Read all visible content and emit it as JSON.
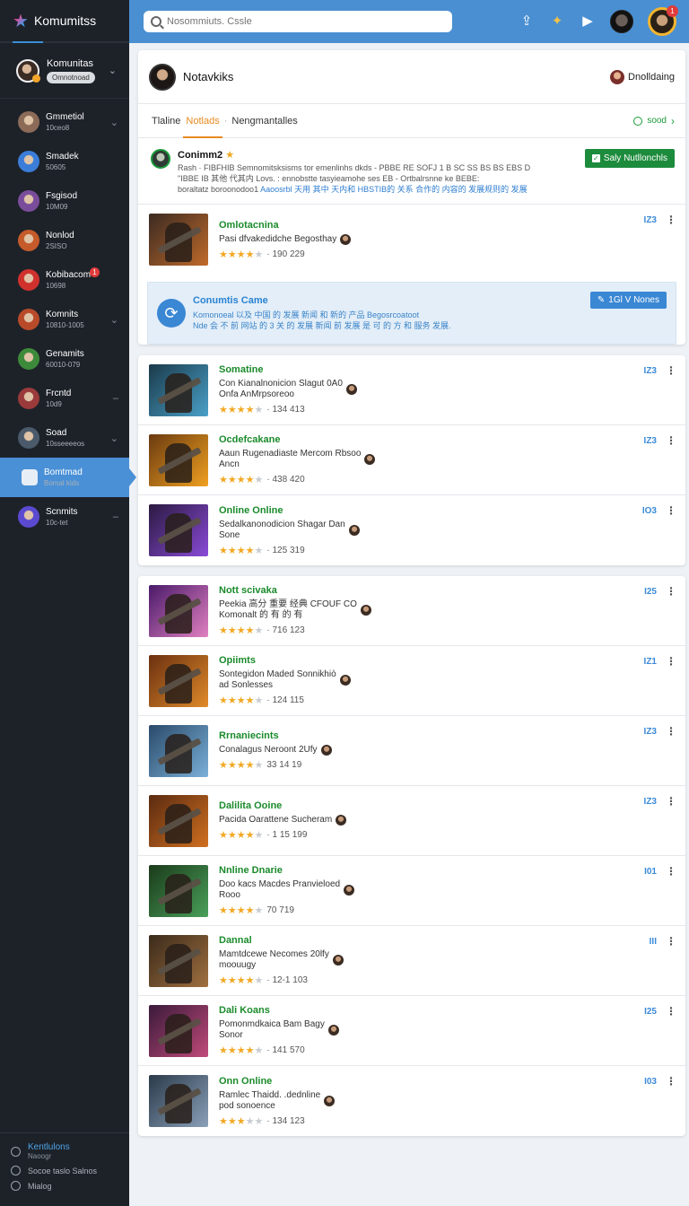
{
  "sidebar": {
    "brand": "Komumitss",
    "profile": {
      "name": "Komunitas",
      "pill": "Omnotnoad"
    },
    "items": [
      {
        "t1": "Gmmetiol",
        "t2": "10ceo8",
        "color": "#8b6b58",
        "chev": "⌄"
      },
      {
        "t1": "Smadek",
        "t2": "50605",
        "color": "#3b7dd8",
        "chev": ""
      },
      {
        "t1": "Fsgisod",
        "t2": "10M09",
        "color": "#7a4d9b",
        "chev": ""
      },
      {
        "t1": "Nonlod",
        "t2": "2SISO",
        "color": "#c55a2a",
        "chev": ""
      },
      {
        "t1": "Kobibacom",
        "t2": "10698",
        "color": "#d0312d",
        "chev": "",
        "badge": "1"
      },
      {
        "t1": "Komnits",
        "t2": "10810-1005",
        "color": "#b84a2a",
        "chev": "⌄"
      },
      {
        "t1": "Genamits",
        "t2": "60010-079",
        "color": "#3c8a3a",
        "chev": ""
      },
      {
        "t1": "Frcntd",
        "t2": "10d9",
        "color": "#9a3a3a",
        "chev": "–"
      },
      {
        "t1": "Soad",
        "t2": "10sseeeeos",
        "color": "#4a5a6a",
        "chev": "⌄"
      },
      {
        "t1": "Bomtmad",
        "t2": "Bomal kids",
        "color": "#2d6cb0",
        "chev": "",
        "active": true
      },
      {
        "t1": "Scnmits",
        "t2": "10c-tet",
        "color": "#5b4ad0",
        "chev": "–"
      }
    ],
    "footer": {
      "line1": "Kentlulons",
      "line1b": "Naoogr",
      "line2": "Socoe taslo Salnos",
      "line3": "Mialog"
    }
  },
  "topbar": {
    "search_placeholder": "Nosommiuts. Cssle"
  },
  "header": {
    "title": "Notavkiks",
    "right_label": "Dnolldaing"
  },
  "tabs": {
    "items": [
      "Tlaline",
      "Notlads",
      "Nengmantalles"
    ],
    "active": 1,
    "right_label": "sood"
  },
  "notice": {
    "title": "Conimm2",
    "text1": "Rash · FIBFHIB Semnomitsksisms tor emenlinhs dkds - PBBE RE SOFJ 1 B SC SS BS BS EBS D",
    "text2": "\"IBBE IB 其他 代其内 Lovs. : ennobstte tasyieamohe ses EB - Ortbalrsnne ke BEBE:",
    "text3": "boraltatz boroonodoo1",
    "text3hl": "Aaoosrbl 天用 其中 天内和 HBSTIB的 关系 合作的 内容的 发展规则的 发展",
    "button": "Saly Nutllonchls"
  },
  "rows_a": [
    {
      "title": "Omlotacnina",
      "desc": "Pasi dfvakedidche Begosthay",
      "desc2": "",
      "rating": 4,
      "meta": "· 190 229",
      "tag": "IZ3",
      "thumb": [
        "#3a2a22",
        "#c06a2a"
      ]
    }
  ],
  "promo": {
    "title": "Conumtis Came",
    "text1": "Komonoeal 以及 中国 的 发展 新闻 和 新的 产品 Begosrcoatoot",
    "text2": "Nde 会 不 前 网站 的 3 关 的 发展 新闻 前 发展 是 可 的 方 和 服务 发展.",
    "button": "1Gl V Nones"
  },
  "rows_b": [
    {
      "title": "Somatine",
      "desc": "Con Kianalnonicion Slagut 0A0",
      "desc2": "Onfa AnMrpsoreoo",
      "rating": 4,
      "meta": "· 134 413",
      "tag": "IZ3",
      "thumb": [
        "#1a3a4a",
        "#4aa0c8"
      ]
    },
    {
      "title": "Ocdefcakane",
      "desc": "Aaun Rugenadiaste Mercom Rbsoo",
      "desc2": "Ancn",
      "rating": 4,
      "meta": "· 438 420",
      "tag": "IZ3",
      "thumb": [
        "#6a3a10",
        "#f0a020"
      ]
    },
    {
      "title": "Online Online",
      "desc": "Sedalkanonodicion Shagar Dan",
      "desc2": "Sone",
      "rating": 4,
      "meta": "· 125 319",
      "tag": "IO3",
      "thumb": [
        "#2a1a40",
        "#8a4ad8"
      ]
    }
  ],
  "rows_c": [
    {
      "title": "Nott scivaka",
      "desc": "Peekia 高分 重要 经典 CFOUF CO",
      "desc2": "Komonalt 的 有 的 有",
      "rating": 4,
      "meta": "· 716 123",
      "tag": "I25",
      "thumb": [
        "#4a1a6a",
        "#e080c0"
      ]
    },
    {
      "title": "Opiimts",
      "desc": "Sontegidon Maded Sonnikhiò",
      "desc2": "ad Sonlesses",
      "rating": 4,
      "meta": "· 124 115",
      "tag": "IZ1",
      "thumb": [
        "#6a3010",
        "#e08a2a"
      ]
    },
    {
      "title": "Rrnaniecints",
      "desc": "Conalagus Neroont 2Ufy",
      "desc2": "",
      "rating": 4,
      "meta": "33 14 19",
      "tag": "IZ3",
      "thumb": [
        "#2a4a6a",
        "#7ab0d8"
      ]
    },
    {
      "title": "Dalilita Ooine",
      "desc": "Pacida Oarattene Sucheram",
      "desc2": "",
      "rating": 4,
      "meta": "· 1 15 199",
      "tag": "IZ3",
      "thumb": [
        "#5a2a10",
        "#d07020"
      ]
    },
    {
      "title": "Nnline Dnarie",
      "desc": "Doo kacs Macdes Pranvieloed",
      "desc2": "Rooo",
      "rating": 4,
      "meta": "70 719",
      "tag": "I01",
      "thumb": [
        "#1a3a1a",
        "#4aa05a"
      ]
    },
    {
      "title": "Dannal",
      "desc": "Mamtdcewe Necomes 20lfy",
      "desc2": "moouugy",
      "rating": 4,
      "meta": "· 12-1 103",
      "tag": "III",
      "thumb": [
        "#3a2a1a",
        "#a07040"
      ]
    },
    {
      "title": "Dali Koans",
      "desc": "Pomonmdkaica Bam Bagy",
      "desc2": "Sonor",
      "rating": 4,
      "meta": "· 141 570",
      "tag": "I25",
      "thumb": [
        "#3a1a3a",
        "#c04a7a"
      ]
    },
    {
      "title": "Onn Online",
      "desc": "Ramlec Thaidd. .dednline",
      "desc2": "pod sonoence",
      "rating": 3,
      "meta": "· 134 123",
      "tag": "I03",
      "thumb": [
        "#2a3a4a",
        "#8aa0b8"
      ]
    }
  ]
}
